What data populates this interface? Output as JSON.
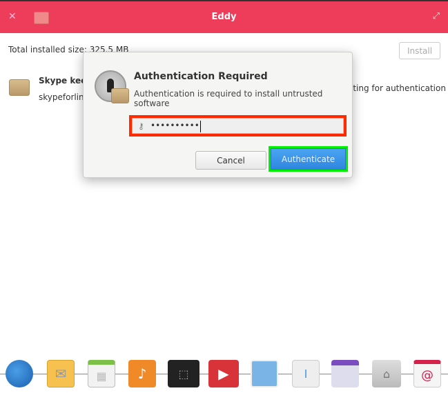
{
  "window": {
    "title": "Eddy",
    "close_icon": "close-icon",
    "maximize_icon": "maximize-icon",
    "accent": "#ee3d5b"
  },
  "main": {
    "total_size": "Total installed size: 325.5 MB",
    "install_label": "Install",
    "package": {
      "name": "Skype keep",
      "id": "skypeforlinu",
      "status": "iting for authentication"
    }
  },
  "dialog": {
    "title": "Authentication Required",
    "message": "Authentication is required to install untrusted software",
    "password_value": "••••••••••",
    "cancel_label": "Cancel",
    "authenticate_label": "Authenticate",
    "highlight_password": "#ff2a00",
    "highlight_authenticate": "#00ee00"
  },
  "dock": {
    "items": [
      "browser",
      "mail",
      "calendar",
      "music",
      "screenshot",
      "videos",
      "photos",
      "system-settings",
      "app-center",
      "files",
      "debian-installer"
    ]
  }
}
